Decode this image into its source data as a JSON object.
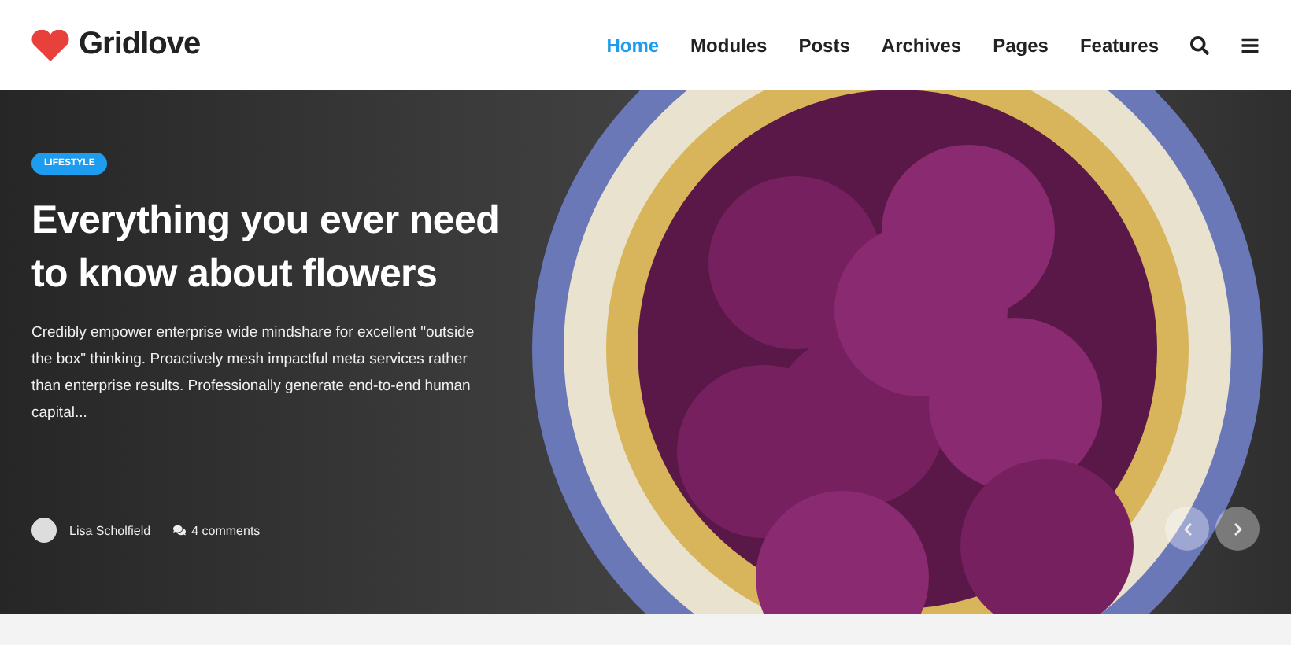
{
  "header": {
    "logo": "Gridlove",
    "nav": [
      {
        "label": "Home",
        "selected": true
      },
      {
        "label": "Modules",
        "selected": false
      },
      {
        "label": "Posts",
        "selected": false
      },
      {
        "label": "Archives",
        "selected": false
      },
      {
        "label": "Pages",
        "selected": false
      },
      {
        "label": "Features",
        "selected": false
      }
    ]
  },
  "hero": {
    "category": "LIFESTYLE",
    "title": "Everything you ever need to know about flowers",
    "excerpt": "Credibly empower enterprise wide mindshare for excellent \"outside the box\" thinking. Proactively mesh impactful meta services rather than enterprise results. Professionally generate end-to-end human capital...",
    "author": "Lisa Scholfield",
    "comments": "4 comments"
  }
}
